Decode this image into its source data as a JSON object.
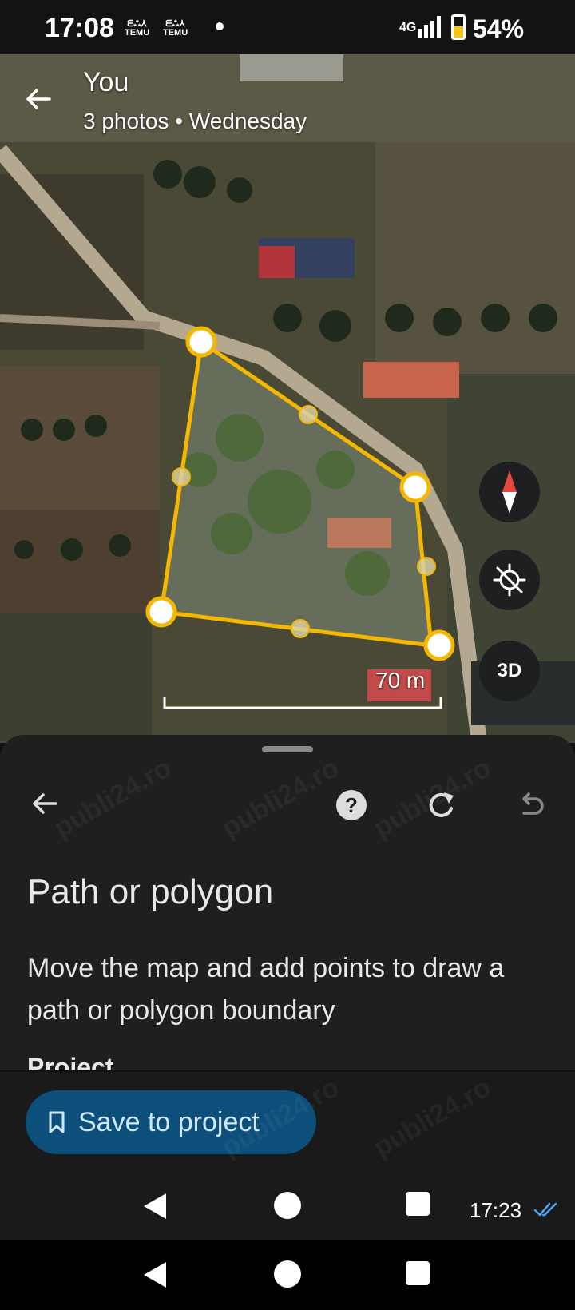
{
  "status_bar": {
    "time": "17:08",
    "notif_1": "TEMU",
    "notif_2": "TEMU",
    "network": "4G",
    "battery": "54%",
    "battery_level": 0.54
  },
  "header": {
    "title": "You",
    "subtitle": "3 photos  •  Wednesday"
  },
  "map": {
    "scale_label": "70 m",
    "btn_3d": "3D",
    "polygon_color": "#f5b800"
  },
  "sheet": {
    "title": "Path or polygon",
    "description": "Move the map and add points to draw a path or polygon boundary",
    "cut_text": "Project"
  },
  "action": {
    "save_label": "Save to project",
    "accent": "#0b4f7a"
  },
  "chat": {
    "time": "17:23"
  },
  "watermark": "publi24.ro"
}
